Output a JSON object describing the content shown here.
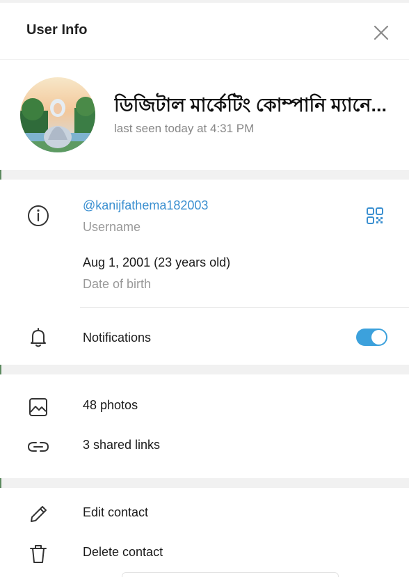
{
  "header": {
    "title": "User Info",
    "close_icon": "close-icon"
  },
  "profile": {
    "name": "ডিজিটাল মার্কেটিং কোম্পানি ম্যানে...",
    "status": "last seen today at 4:31 PM"
  },
  "info": {
    "username": {
      "value": "@kanijfathema182003",
      "label": "Username",
      "icon": "info-icon",
      "qr_icon": "qr-code-icon"
    },
    "birthday": {
      "value": "Aug 1, 2001 (23 years old)",
      "label": "Date of birth"
    },
    "notifications": {
      "label": "Notifications",
      "enabled": true,
      "icon": "bell-icon"
    }
  },
  "media": {
    "photos": {
      "label": "48 photos",
      "icon": "image-icon"
    },
    "links": {
      "label": "3 shared links",
      "icon": "link-icon"
    }
  },
  "actions": {
    "edit": {
      "label": "Edit contact",
      "icon": "pencil-icon"
    },
    "delete": {
      "label": "Delete contact",
      "icon": "trash-icon"
    }
  },
  "colors": {
    "accent": "#3ca1dc",
    "link": "#3a8fd0",
    "muted": "#999999",
    "background": "#f1f1f1"
  }
}
